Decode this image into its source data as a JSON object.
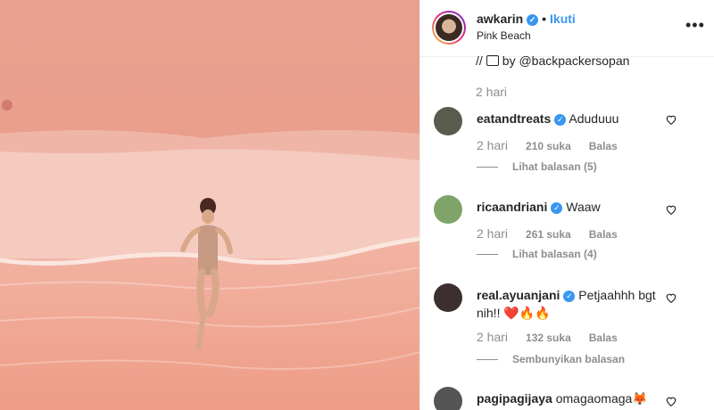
{
  "post": {
    "username": "awkarin",
    "follow_label": "Ikuti",
    "dot": "•",
    "location": "Pink Beach",
    "more_glyph": "•••",
    "caption_tail": "by @backpackersopan",
    "caption_prefix": "//",
    "caption_time": "2 hari"
  },
  "comments": [
    {
      "user": "eatandtreats",
      "text": "Aduduuu",
      "time": "2 hari",
      "likes": "210 suka",
      "reply": "Balas",
      "replies": "Lihat balasan (5)",
      "avatar_color": "#5a5a4e"
    },
    {
      "user": "ricaandriani",
      "text": "Waaw",
      "time": "2 hari",
      "likes": "261 suka",
      "reply": "Balas",
      "replies": "Lihat balasan (4)",
      "avatar_color": "#7fa46a"
    },
    {
      "user": "real.ayuanjani",
      "text": "Petjaahhh bgt",
      "text2": "nih!! ❤️🔥🔥",
      "time": "2 hari",
      "likes": "132 suka",
      "reply": "Balas",
      "replies": "Sembunyikan balasan",
      "avatar_color": "#3b2f2f"
    },
    {
      "user": "pagipagijaya",
      "text": "omagaomaga🦊",
      "avatar_color": "#555555"
    }
  ],
  "colors": {
    "accent": "#3897f0",
    "sand": "#e79a86",
    "surf": "#f7d2c8"
  }
}
